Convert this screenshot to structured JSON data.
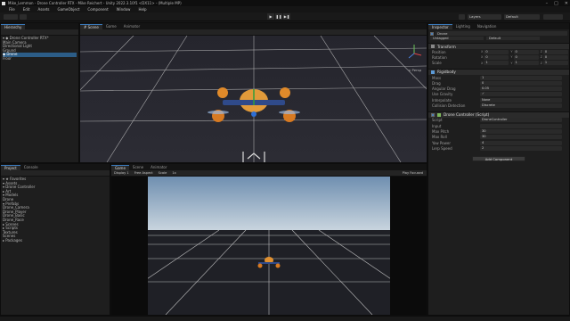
{
  "window": {
    "title": "Mike_Lemmon - Drone Controller RTX - Mike Reichert - Unity 2022.3.10f1 <DX11> - (Multiple MP)",
    "controls": [
      "–",
      "□",
      "✕"
    ]
  },
  "menubar": [
    "File",
    "Edit",
    "Assets",
    "GameObject",
    "Component",
    "Window",
    "Help"
  ],
  "toolbar": {
    "play": "▶",
    "pause": "❚❚",
    "step": "▶❚",
    "layers": "Layers",
    "layout": "Default"
  },
  "hierarchy": {
    "tab": "Hierarchy",
    "items": [
      "▾ ◆ Drone Controller RTX*",
      "   Main Camera",
      "   Directional Light",
      "   Ground",
      "   ◆ Drone",
      "   Floor"
    ],
    "selected_index": 4
  },
  "scene": {
    "tabs": [
      "# Scene",
      "Game",
      "Animator"
    ],
    "gizmo_label": "< Persp"
  },
  "project": {
    "tabs": [
      "Project",
      "Console"
    ],
    "items": [
      "▾ ★ Favorites",
      "▾ Assets",
      "  ▾ Drone Controller",
      "    ▸ Art",
      "    ▾ Models",
      "      Drone",
      "    ▾ Prefabs",
      "      Drone_Camera",
      "      Drone_Player",
      "      Drone_Basic",
      "      Drone_Race",
      "    ▸ Scenes",
      "    ▸ Scripts",
      "    Textures",
      "  Scenes",
      "▸ Packages"
    ]
  },
  "game": {
    "tabs": [
      "Game",
      "Scene",
      "Animator"
    ],
    "display": "Display 1",
    "aspect": "Free Aspect",
    "scale_label": "Scale",
    "scale_value": "1x",
    "play_mode": "Play Focused"
  },
  "inspector": {
    "tabs": [
      "Inspector",
      "Lighting",
      "Navigation"
    ],
    "object_name": "Drone",
    "tag": "Untagged",
    "layer": "Default",
    "transform": {
      "title": "Transform",
      "rows": [
        {
          "label": "Position",
          "x": "0",
          "y": "0",
          "z": "0"
        },
        {
          "label": "Rotation",
          "x": "0",
          "y": "0",
          "z": "0"
        },
        {
          "label": "Scale",
          "x": "1",
          "y": "1",
          "z": "1"
        }
      ]
    },
    "rigidbody": {
      "title": "Rigidbody",
      "rows": [
        {
          "label": "Mass",
          "value": "1"
        },
        {
          "label": "Drag",
          "value": "0"
        },
        {
          "label": "Angular Drag",
          "value": "0.05"
        },
        {
          "label": "Use Gravity",
          "value": "✓"
        },
        {
          "label": "Interpolate",
          "value": "None"
        },
        {
          "label": "Collision Detection",
          "value": "Discrete"
        }
      ]
    },
    "controller": {
      "title": "Drone Controller (Script)",
      "rows": [
        {
          "label": "Script",
          "value": "DroneController"
        },
        {
          "label": "Input",
          "value": ""
        },
        {
          "label": "Max Pitch",
          "value": "30"
        },
        {
          "label": "Max Roll",
          "value": "30"
        },
        {
          "label": "Yaw Power",
          "value": "4"
        },
        {
          "label": "Lerp Speed",
          "value": "2"
        }
      ]
    },
    "add_component": "Add Component"
  }
}
